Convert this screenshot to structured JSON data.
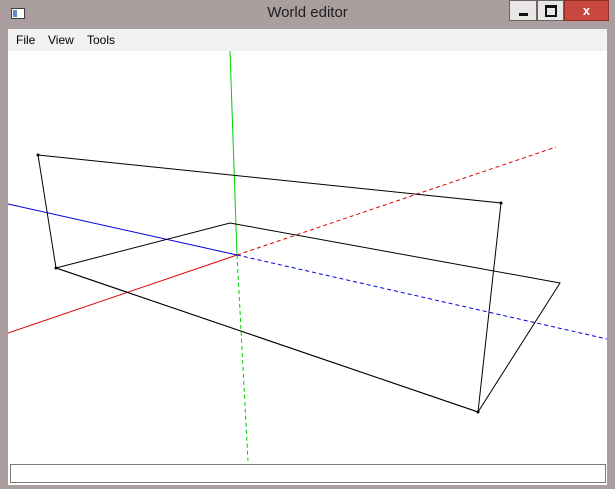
{
  "window": {
    "title": "World editor",
    "close_glyph": "x",
    "icons": {
      "app": "app-window-icon",
      "minimize": "minimize-icon",
      "maximize": "maximize-icon",
      "close": "close-icon"
    },
    "colors": {
      "frame": "#ab9e9f",
      "close_button": "#c9483d",
      "axis_x": "#e00000",
      "axis_y": "#00d000",
      "axis_z": "#0000e0",
      "geometry": "#000000"
    }
  },
  "menubar": {
    "items": [
      {
        "label": "File"
      },
      {
        "label": "View"
      },
      {
        "label": "Tools"
      }
    ]
  },
  "statusbar": {
    "value": ""
  }
}
